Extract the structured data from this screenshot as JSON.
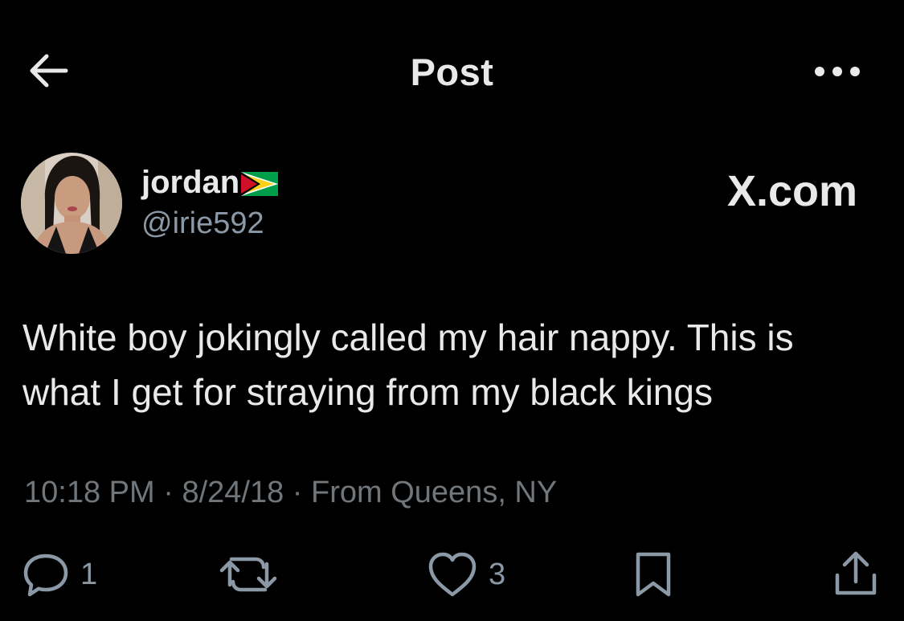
{
  "header": {
    "title": "Post",
    "back_icon": "arrow-left-icon",
    "more_icon": "more-horizontal-icon"
  },
  "author": {
    "display_name": "jordan",
    "flag_icon": "guyana-flag-icon",
    "handle": "@irie592"
  },
  "site_label": "X.com",
  "post": {
    "text": "White boy jokingly called my hair nappy. This is what I get for straying from my black kings"
  },
  "meta": {
    "time": "10:18 PM",
    "separator": "·",
    "date": "8/24/18",
    "location": "From Queens, NY"
  },
  "actions": {
    "reply_count": "1",
    "repost_count": "",
    "like_count": "3"
  },
  "colors": {
    "background": "#000000",
    "primary_text": "#e7e9ea",
    "secondary_text": "#71767b"
  }
}
